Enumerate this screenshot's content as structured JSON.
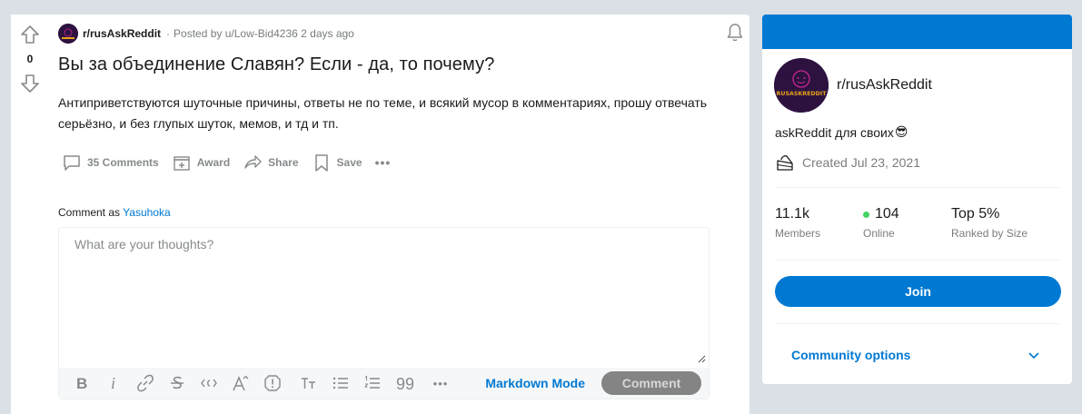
{
  "post": {
    "vote_count": "0",
    "subreddit": "r/rusAskReddit",
    "meta_sep": "·",
    "posted_by": "Posted by u/Low-Bid4236",
    "time_ago": "2 days ago",
    "title": "Вы за объединение Славян? Если - да, то почему?",
    "body": "Антиприветствуются шуточные причины, ответы не по теме, и всякий мусор в комментариях, прошу отвечать серьёзно, и без глупых шуток, мемов, и тд и тп.",
    "actions": {
      "comments": "35 Comments",
      "award": "Award",
      "share": "Share",
      "save": "Save",
      "more": "•••"
    }
  },
  "comment_box": {
    "comment_as_prefix": "Comment as",
    "username": "Yasuhoka",
    "placeholder": "What are your thoughts?",
    "toolbar": {
      "markdown_mode": "Markdown Mode",
      "comment": "Comment",
      "more": "•••"
    }
  },
  "sidebar": {
    "avatar_text": "RUSASKREDDIT",
    "community_name": "r/rusAskReddit",
    "description": "askReddit для своих",
    "description_emoji": "😎",
    "created": "Created Jul 23, 2021",
    "stats": [
      {
        "value": "11.1k",
        "label": "Members"
      },
      {
        "value": "104",
        "label": "Online"
      },
      {
        "value": "Top 5%",
        "label": "Ranked by Size"
      }
    ],
    "join": "Join",
    "community_options": "Community options"
  },
  "colors": {
    "accent": "#0079d3",
    "page_bg": "#dae0e6",
    "online": "#46d160",
    "avatar_bg": "#2d1240"
  }
}
